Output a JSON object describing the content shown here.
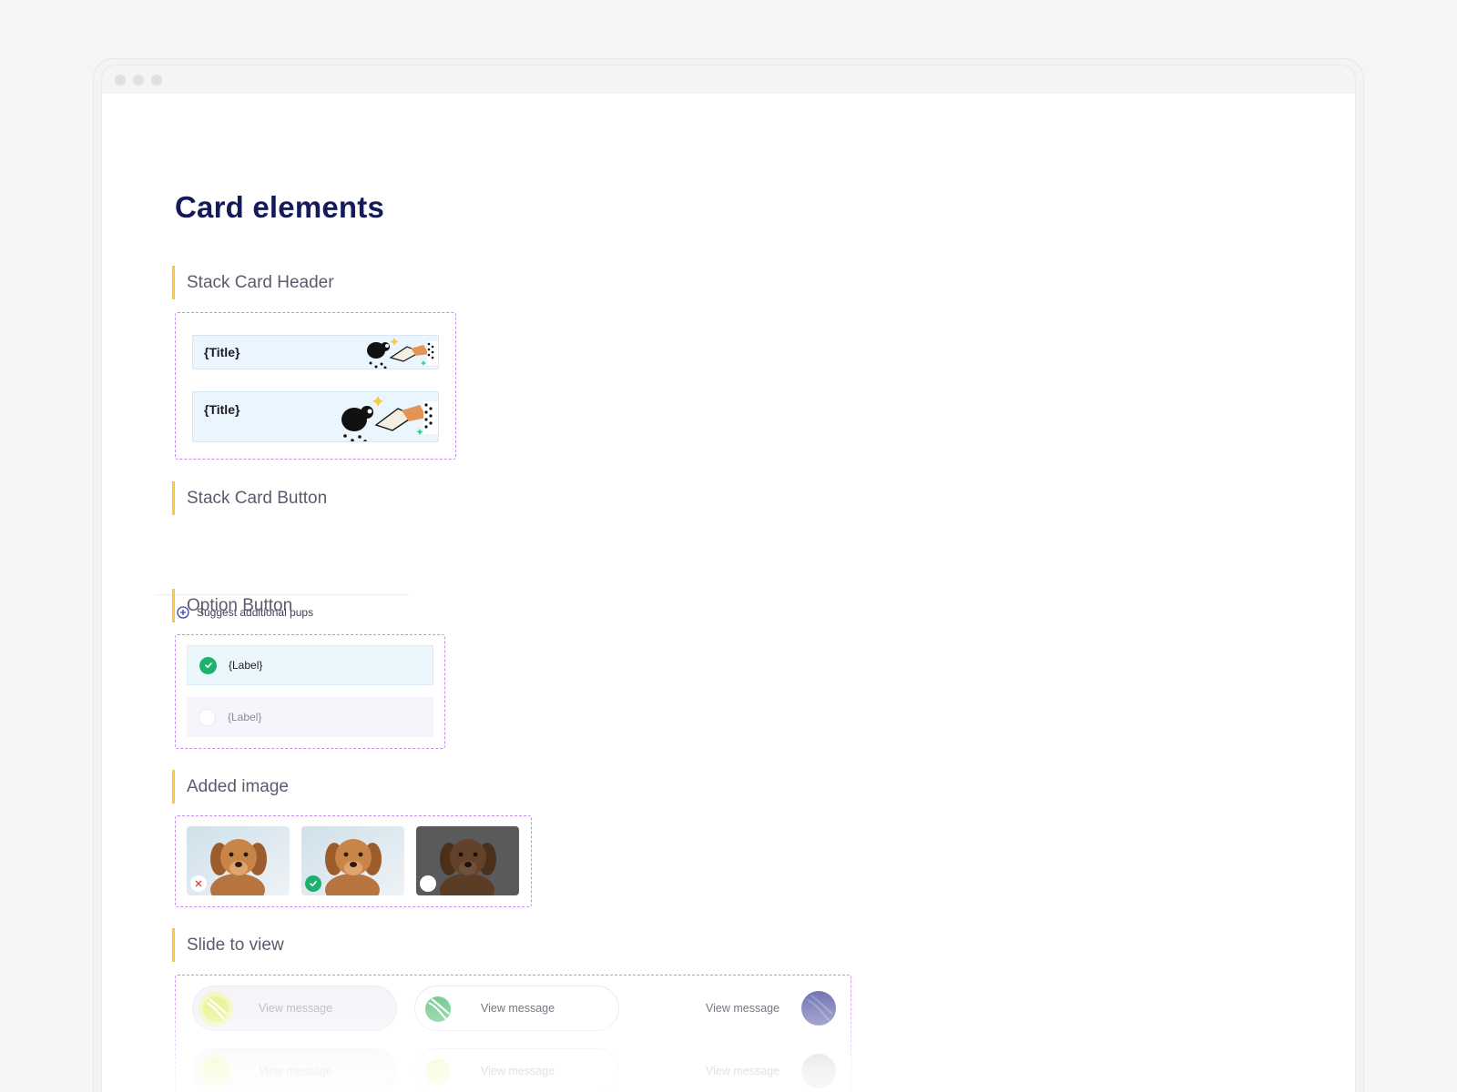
{
  "page": {
    "title": "Card elements"
  },
  "sections": {
    "stack_card_header": {
      "heading": "Stack Card Header",
      "cards": [
        {
          "title": "{Title}"
        },
        {
          "title": "{Title}"
        }
      ]
    },
    "stack_card_button": {
      "heading": "Stack Card Button",
      "button_label": "Suggest additional pups"
    },
    "option_button": {
      "heading": "Option Button",
      "options": [
        {
          "label": "{Label}",
          "state": "selected"
        },
        {
          "label": "{Label}",
          "state": "unselected"
        }
      ]
    },
    "added_image": {
      "heading": "Added image",
      "images": [
        {
          "state": "remove"
        },
        {
          "state": "selected"
        },
        {
          "state": "unselected"
        }
      ]
    },
    "slide_to_view": {
      "heading": "Slide to view",
      "rows": [
        [
          "View message",
          "View message",
          "View message"
        ],
        [
          "View message",
          "View message",
          "View message"
        ]
      ]
    }
  },
  "colors": {
    "accent_yellow": "#f6c843",
    "dashed_purple": "#c98bf1",
    "title_navy": "#141a5a",
    "check_green": "#1eb06f"
  }
}
